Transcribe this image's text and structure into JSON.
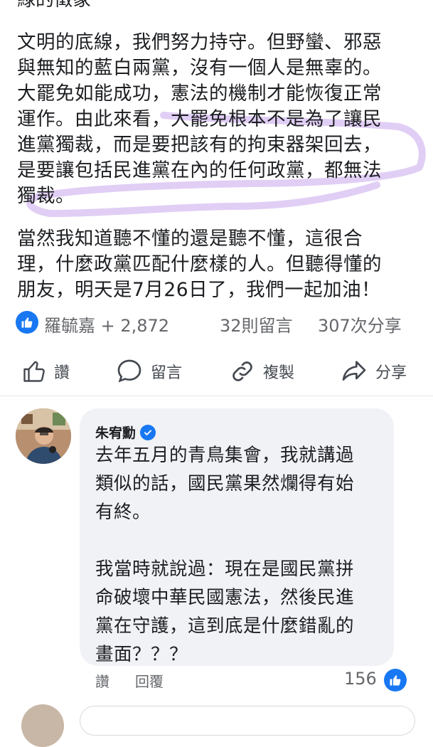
{
  "post": {
    "cut_line": "綠的徵象",
    "paragraph1": [
      "文明的底線，我們努力持守。但野蠻、邪惡",
      "與無知的藍白兩黨，沒有一個人是無辜的。",
      "大罷免如能成功，憲法的機制才能恢復正常",
      "運作。由此來看，大罷免根本不是為了讓民",
      "進黨獨裁，而是要把該有的拘束器架回去，",
      "是要讓包括民進黨在內的任何政黨，都無法",
      "獨裁。"
    ],
    "paragraph2": [
      "當然我知道聽不懂的還是聽不懂，這很合",
      "理，什麼政黨匹配什麼樣的人。但聽得懂的",
      "朋友，明天是7月26日了，我們一起加油！"
    ],
    "highlight_color": "#c9a5ec"
  },
  "stats": {
    "reactors": "羅毓嘉 + 2,872",
    "comments": "32則留言",
    "shares": "307次分享"
  },
  "actions": {
    "like": "讚",
    "comment": "留言",
    "copy": "複製",
    "share": "分享"
  },
  "comment": {
    "author": "朱宥勳",
    "body_part1": [
      "去年五月的青鳥集會，我就講過",
      "類似的話，國民黨果然爛得有始",
      "有終。"
    ],
    "body_part2": [
      "我當時就說過：現在是國民黨拼",
      "命破壞中華民國憲法，然後民進",
      "黨在守護，這到底是什麼錯亂的",
      "畫面？？？"
    ],
    "like_label": "讚",
    "reply_label": "回覆",
    "reaction_count": "156"
  },
  "colors": {
    "accent": "#1877f2",
    "text": "#1c1e21",
    "secondary": "#65676b",
    "bubble": "#f0f2f5"
  },
  "icons": [
    "like-icon",
    "thumbs-up-icon",
    "comment-icon",
    "link-icon",
    "share-icon",
    "verified-badge-icon"
  ]
}
